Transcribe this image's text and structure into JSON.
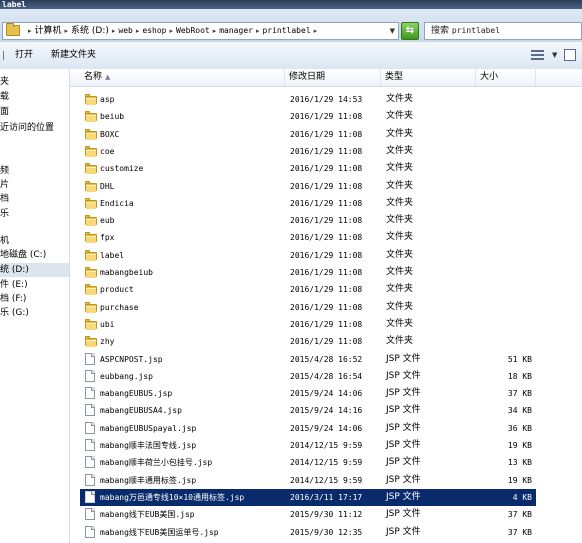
{
  "window": {
    "title_fragment": "label"
  },
  "address": {
    "crumbs": [
      {
        "label": "计算机",
        "cjk": true
      },
      {
        "label": "系统 (D:)",
        "cjk": true
      },
      {
        "label": "web",
        "cjk": false
      },
      {
        "label": "eshop",
        "cjk": false
      },
      {
        "label": "WebRoot",
        "cjk": false
      },
      {
        "label": "manager",
        "cjk": false
      },
      {
        "label": "printlabel",
        "cjk": false
      }
    ],
    "search_placeholder_prefix": "搜索",
    "search_placeholder_folder": "printlabel"
  },
  "toolbar": {
    "open_label": "打开",
    "new_folder_label": "新建文件夹"
  },
  "nav": {
    "items": [
      {
        "label": "夹"
      },
      {
        "label": "载"
      },
      {
        "label": "面"
      },
      {
        "label": "近访问的位置"
      },
      {
        "label": ""
      },
      {
        "label": ""
      },
      {
        "label": "频"
      },
      {
        "label": "片"
      },
      {
        "label": "档"
      },
      {
        "label": "乐"
      },
      {
        "label": ""
      },
      {
        "label": "机"
      },
      {
        "label": "地磁盘 (C:)"
      },
      {
        "label": "统 (D:)"
      },
      {
        "label": "件 (E:)"
      },
      {
        "label": "档 (F:)"
      },
      {
        "label": "乐 (G:)"
      }
    ]
  },
  "columns": {
    "name": "名称",
    "date": "修改日期",
    "type": "类型",
    "size": "大小"
  },
  "files": [
    {
      "name": "asp",
      "date": "2016/1/29 14:53",
      "type": "文件夹",
      "size": "",
      "kind": "folder"
    },
    {
      "name": "beiub",
      "date": "2016/1/29 11:08",
      "type": "文件夹",
      "size": "",
      "kind": "folder"
    },
    {
      "name": "BOXC",
      "date": "2016/1/29 11:08",
      "type": "文件夹",
      "size": "",
      "kind": "folder"
    },
    {
      "name": "coe",
      "date": "2016/1/29 11:08",
      "type": "文件夹",
      "size": "",
      "kind": "folder"
    },
    {
      "name": "customize",
      "date": "2016/1/29 11:08",
      "type": "文件夹",
      "size": "",
      "kind": "folder"
    },
    {
      "name": "DHL",
      "date": "2016/1/29 11:08",
      "type": "文件夹",
      "size": "",
      "kind": "folder"
    },
    {
      "name": "Endicia",
      "date": "2016/1/29 11:08",
      "type": "文件夹",
      "size": "",
      "kind": "folder"
    },
    {
      "name": "eub",
      "date": "2016/1/29 11:08",
      "type": "文件夹",
      "size": "",
      "kind": "folder"
    },
    {
      "name": "fpx",
      "date": "2016/1/29 11:08",
      "type": "文件夹",
      "size": "",
      "kind": "folder"
    },
    {
      "name": "label",
      "date": "2016/1/29 11:08",
      "type": "文件夹",
      "size": "",
      "kind": "folder"
    },
    {
      "name": "mabangbeiub",
      "date": "2016/1/29 11:08",
      "type": "文件夹",
      "size": "",
      "kind": "folder"
    },
    {
      "name": "product",
      "date": "2016/1/29 11:08",
      "type": "文件夹",
      "size": "",
      "kind": "folder"
    },
    {
      "name": "purchase",
      "date": "2016/1/29 11:08",
      "type": "文件夹",
      "size": "",
      "kind": "folder"
    },
    {
      "name": "ubi",
      "date": "2016/1/29 11:08",
      "type": "文件夹",
      "size": "",
      "kind": "folder"
    },
    {
      "name": "zhy",
      "date": "2016/1/29 11:08",
      "type": "文件夹",
      "size": "",
      "kind": "folder"
    },
    {
      "name": "ASPCNPOST.jsp",
      "date": "2015/4/28 16:52",
      "type": "JSP 文件",
      "size": "51 KB",
      "kind": "file"
    },
    {
      "name": "eubbang.jsp",
      "date": "2015/4/28 16:54",
      "type": "JSP 文件",
      "size": "18 KB",
      "kind": "file"
    },
    {
      "name": "mabangEUBUS.jsp",
      "date": "2015/9/24 14:06",
      "type": "JSP 文件",
      "size": "37 KB",
      "kind": "file"
    },
    {
      "name": "mabangEUBUSA4.jsp",
      "date": "2015/9/24 14:16",
      "type": "JSP 文件",
      "size": "34 KB",
      "kind": "file"
    },
    {
      "name": "mabangEUBUSpayal.jsp",
      "date": "2015/9/24 14:06",
      "type": "JSP 文件",
      "size": "36 KB",
      "kind": "file"
    },
    {
      "name": "mabang顺丰法国专线.jsp",
      "date": "2014/12/15 9:59",
      "type": "JSP 文件",
      "size": "19 KB",
      "kind": "file"
    },
    {
      "name": "mabang顺丰荷兰小包挂号.jsp",
      "date": "2014/12/15 9:59",
      "type": "JSP 文件",
      "size": "13 KB",
      "kind": "file"
    },
    {
      "name": "mabang顺丰通用标签.jsp",
      "date": "2014/12/15 9:59",
      "type": "JSP 文件",
      "size": "19 KB",
      "kind": "file"
    },
    {
      "name": "mabang万邑通专线10×10通用标签.jsp",
      "date": "2016/3/11 17:17",
      "type": "JSP 文件",
      "size": "4 KB",
      "kind": "file",
      "selected": true
    },
    {
      "name": "mabang线下EUB美国.jsp",
      "date": "2015/9/30 11:12",
      "type": "JSP 文件",
      "size": "37 KB",
      "kind": "file"
    },
    {
      "name": "mabang线下EUB美国运单号.jsp",
      "date": "2015/9/30 12:35",
      "type": "JSP 文件",
      "size": "37 KB",
      "kind": "file"
    }
  ],
  "colors": {
    "selection": "#0a2b6b",
    "folder": "#e9bf47"
  }
}
